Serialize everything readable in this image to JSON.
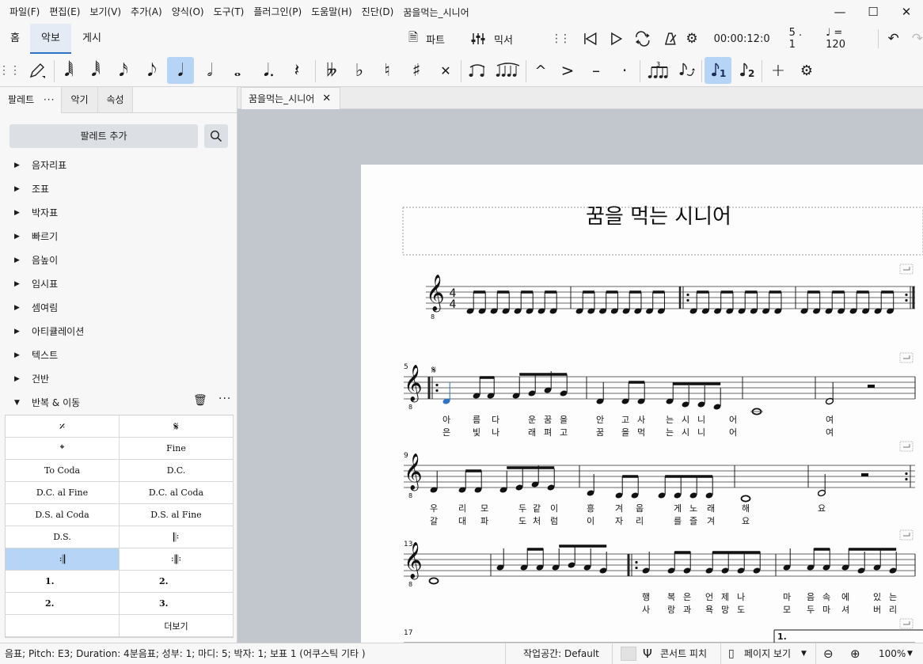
{
  "menu": {
    "items": [
      "파일(F)",
      "편집(E)",
      "보기(V)",
      "추가(A)",
      "양식(O)",
      "도구(T)",
      "플러그인(P)",
      "도움말(H)",
      "진단(D)"
    ],
    "doc_title": "꿈을먹는_시니어"
  },
  "window": {
    "minimize": "—",
    "maximize": "☐",
    "close": "✕"
  },
  "tabs": {
    "home": "홈",
    "score": "악보",
    "publish": "게시"
  },
  "toolbar_right": {
    "parts_label": "파트",
    "mixer_label": "믹서",
    "time": "00:00:12:0",
    "position": "5 . 1",
    "tempo": "♩ = 120"
  },
  "note_toolbar": {
    "icons": [
      "pencil-icon",
      "64th-note-icon",
      "32nd-note-icon",
      "16th-note-icon",
      "8th-note-icon",
      "quarter-note-icon",
      "half-note-icon",
      "whole-note-icon",
      "dot-icon",
      "rest-icon",
      "double-flat-icon",
      "flat-icon",
      "natural-icon",
      "sharp-icon",
      "double-sharp-icon",
      "tie-icon",
      "slur-icon",
      "marcato-icon",
      "accent-icon",
      "tenuto-icon",
      "staccato-icon",
      "tuplet-icon",
      "flip-icon",
      "voice-1-icon",
      "voice-2-icon",
      "add-icon",
      "settings-icon"
    ]
  },
  "left_panel": {
    "tabs": [
      "팔레트",
      "악기",
      "속성"
    ],
    "more_dots": "···",
    "add_palette": "팔레트 추가",
    "palettes": [
      "음자리표",
      "조표",
      "박자표",
      "빠르기",
      "음높이",
      "임시표",
      "셈여림",
      "아티큘레이션",
      "텍스트",
      "건반",
      "반복 & 이동"
    ],
    "repeat_cells": [
      "𝄎",
      "𝄋",
      "𝄌",
      "Fine",
      "To Coda",
      "D.C.",
      "D.C. al Fine",
      "D.C. al Coda",
      "D.S. al Coda",
      "D.S. al Fine",
      "D.S.",
      "𝄆",
      "𝄇",
      "𝄇𝄆",
      "1.",
      "2.",
      "2.",
      "3.",
      "",
      "더보기"
    ],
    "selected_cell": 12
  },
  "document_tab": {
    "label": "꿈을먹는_시니어",
    "close": "✕"
  },
  "score": {
    "title": "꿈을 먹는 시니어",
    "time_sig_top": "4",
    "time_sig_bottom": "4",
    "measure_numbers": [
      "5",
      "9",
      "13",
      "17"
    ],
    "lyrics_sys2_v1": [
      "아",
      "름",
      "다",
      "운",
      "꿈",
      "을",
      "안",
      "고",
      "사",
      "는",
      "시",
      "니",
      "어",
      "여"
    ],
    "lyrics_sys2_v2": [
      "은",
      "빛",
      "나",
      "래",
      "펴",
      "고",
      "꿈",
      "을",
      "먹",
      "는",
      "시",
      "니",
      "어",
      "여"
    ],
    "lyrics_sys3_v1": [
      "우",
      "리",
      "모",
      "두",
      "같",
      "이",
      "흥",
      "겨",
      "웁",
      "게",
      "노",
      "래",
      "해",
      "요"
    ],
    "lyrics_sys3_v2": [
      "갈",
      "대",
      "파",
      "도",
      "처",
      "럼",
      "이",
      "자",
      "리",
      "를",
      "즐",
      "겨",
      "요"
    ],
    "lyrics_sys4_v1": [
      "행",
      "복",
      "은",
      "언",
      "제",
      "나",
      "마",
      "음",
      "속",
      "에",
      "있",
      "는"
    ],
    "lyrics_sys4_v2": [
      "사",
      "랑",
      "과",
      "욕",
      "망",
      "도",
      "모",
      "두",
      "마",
      "셔",
      "버",
      "리"
    ],
    "volta_label": "1.",
    "segno": "𝄋"
  },
  "status": {
    "selection": "음표; Pitch: E3; Duration: 4분음표; 성부: 1; 마디: 5; 박자: 1; 보표 1 (어쿠스틱 기타 )",
    "workspace": "작업공간: Default",
    "concert_pitch": "콘서트 피치",
    "page_view": "페이지 보기",
    "zoom": "100%"
  },
  "colors": {
    "accent": "#2d75c4",
    "selected": "#b6d5f6",
    "canvas": "#c2c6cd"
  }
}
